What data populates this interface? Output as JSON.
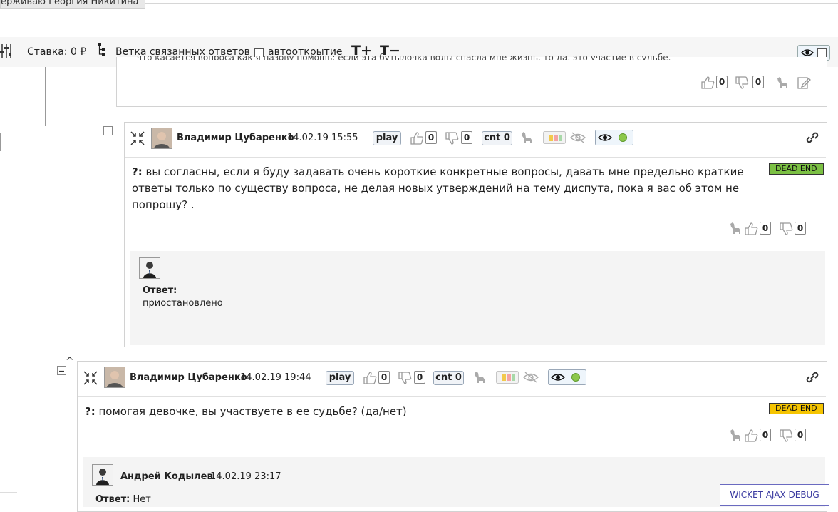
{
  "header": {
    "banner_text": "ерживаю Георгия Никитина"
  },
  "toolbar": {
    "stake_label": "Ставка: 0 ₽",
    "branch_label": "Ветка связанных ответов",
    "autoopen_label": "автооткрытие",
    "font_increase": "T+",
    "font_decrease": "T−"
  },
  "previous_comment": {
    "text_fragment": "что касается вопроса как я назову помощь: если эта бутылочка воды спасла мне жизнь, то да, это участие в судьбе.",
    "likes": "0",
    "dislikes": "0"
  },
  "comments": [
    {
      "author": "Владимир Цубаренко",
      "date": "14.02.19 15:55",
      "play_label": "play",
      "likes": "0",
      "dislikes": "0",
      "cnt_label": "cnt 0",
      "badge": "DEAD END",
      "question_prefix": "?:",
      "question": "вы согласны, если я буду задавать очень короткие конкретные вопросы, давать мне предельно краткие ответы только по существу вопроса, не делая новых утверждений на тему диспута, пока я вас об этом не попрошу? .",
      "body_likes": "0",
      "body_dislikes": "0",
      "answer_label": "Ответ:",
      "answer_text": "приостановлено"
    },
    {
      "author": "Владимир Цубаренко",
      "date": "14.02.19 19:44",
      "play_label": "play",
      "likes": "0",
      "dislikes": "0",
      "cnt_label": "cnt 0",
      "badge": "DEAD END",
      "question_prefix": "?:",
      "question": "помогая девочке, вы участвуете в ее судьбе? (да/нет)",
      "body_likes": "0",
      "body_dislikes": "0",
      "answer_author": "Андрей Кодылев",
      "answer_date": "14.02.19 23:17",
      "answer_label": "Ответ:",
      "answer_text": "Нет"
    }
  ],
  "debug": {
    "label": "WICKET AJAX DEBUG"
  },
  "colors": {
    "dead_end_green": "#7bc043",
    "dead_end_yellow": "#f5c400",
    "debug_link": "#3a3aa0"
  }
}
